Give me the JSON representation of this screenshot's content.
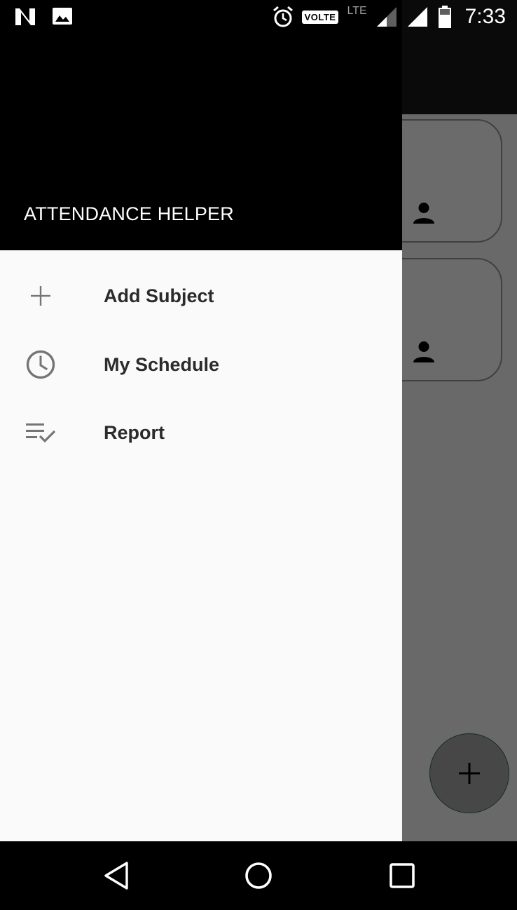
{
  "status_bar": {
    "left_icons": [
      "n-notification-icon",
      "image-notification-icon"
    ],
    "right_icons": [
      "alarm-icon",
      "volte-badge",
      "lte-icon",
      "signal-icon",
      "signal-icon",
      "battery-icon"
    ],
    "volte_label": "VOLTE",
    "lte_label": "LTE",
    "time": "7:33"
  },
  "drawer": {
    "header_title": "ATTENDANCE HELPER",
    "items": [
      {
        "label": "Add Subject",
        "icon": "plus-icon"
      },
      {
        "label": "My Schedule",
        "icon": "clock-icon"
      },
      {
        "label": "Report",
        "icon": "playlist-check-icon"
      }
    ]
  },
  "background": {
    "cards": [
      "person-icon",
      "person-icon"
    ],
    "fab_icon": "plus-icon"
  },
  "nav_bar": {
    "buttons": [
      "back-icon",
      "home-icon",
      "recents-icon"
    ]
  },
  "colors": {
    "drawer_header": "#000000",
    "drawer_body": "#fafafa",
    "menu_text": "#2b2b2b",
    "icon_gray": "#757575",
    "fab_border": "#2e6b57",
    "scrim": "rgba(0,0,0,0.58)"
  }
}
